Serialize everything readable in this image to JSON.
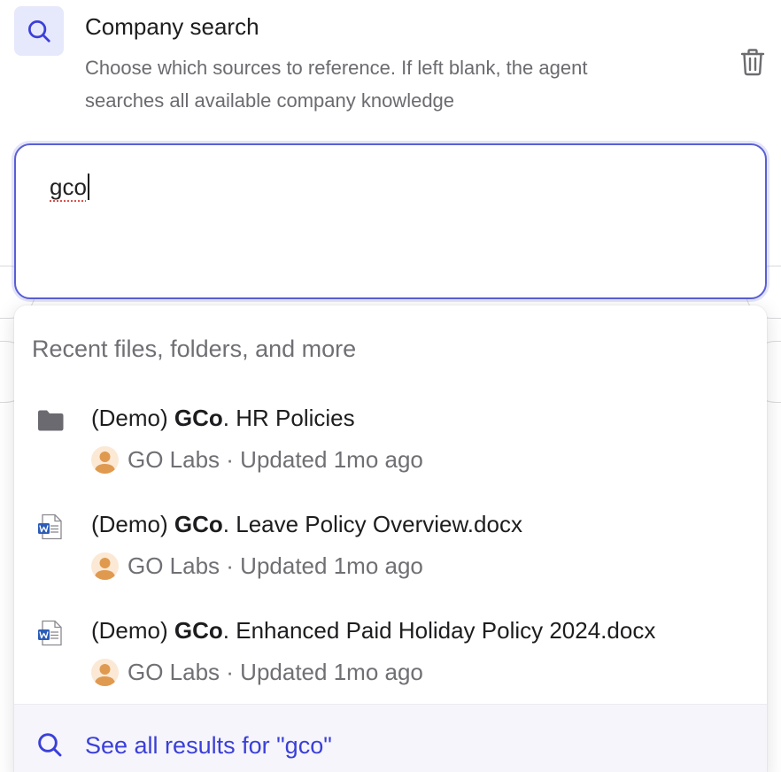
{
  "header": {
    "icon": "search-icon",
    "title": "Company search",
    "description_line1": "Choose which sources to reference. If left blank, the agent",
    "description_line2": "searches all available company knowledge",
    "delete_icon": "trash-icon"
  },
  "search": {
    "value": "gco"
  },
  "dropdown": {
    "header": "Recent files, folders, and more",
    "results": [
      {
        "icon": "folder-icon",
        "prefix": "(Demo) ",
        "highlight": "GCo",
        "suffix": ". HR Policies",
        "owner": "GO Labs",
        "updated": "· Updated 1mo ago"
      },
      {
        "icon": "word-doc-icon",
        "prefix": "(Demo) ",
        "highlight": "GCo",
        "suffix": ". Leave Policy Overview.docx",
        "owner": "GO Labs",
        "updated": "· Updated 1mo ago"
      },
      {
        "icon": "word-doc-icon",
        "prefix": "(Demo) ",
        "highlight": "GCo",
        "suffix": ". Enhanced Paid Holiday Policy 2024.docx",
        "owner": "GO Labs",
        "updated": "· Updated 1mo ago"
      }
    ],
    "see_all": "See all results for \"gco\""
  },
  "colors": {
    "accent": "#3b3fd8",
    "focus_border": "#5a5fd6",
    "badge_bg": "#e6e8fb",
    "avatar": "#e09a4f"
  }
}
